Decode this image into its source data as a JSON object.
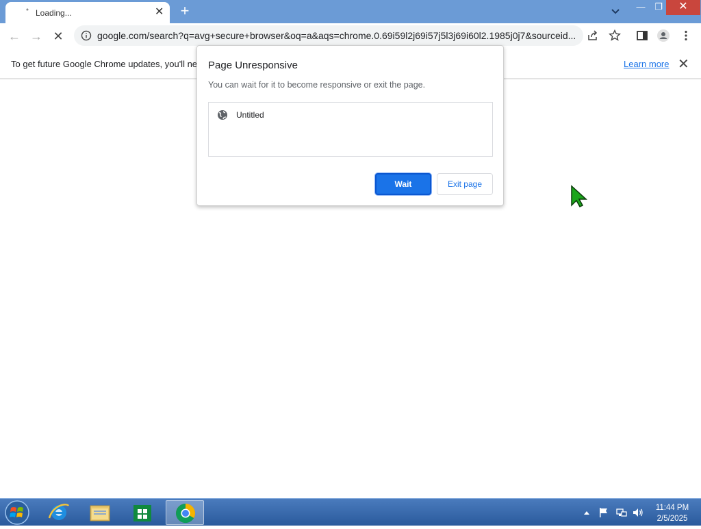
{
  "browser": {
    "tab": {
      "title": "Loading...",
      "spinner": "*"
    },
    "new_tab": "+",
    "window_controls": {
      "minimize": "—",
      "maximize": "❐",
      "close": "✕"
    },
    "nav": {
      "back": "←",
      "forward": "→",
      "stop": "✕"
    },
    "omnibox": {
      "url": "google.com/search?q=avg+secure+browser&oq=a&aqs=chrome.0.69i59l2j69i57j5l3j69i60l2.1985j0j7&sourceid..."
    }
  },
  "infobar": {
    "message": "To get future Google Chrome updates, you'll ne",
    "learn_more": "Learn more",
    "close": "✕"
  },
  "dialog": {
    "title": "Page Unresponsive",
    "text": "You can wait for it to become responsive or exit the page.",
    "pages": [
      "Untitled"
    ],
    "wait_label": "Wait",
    "exit_label": "Exit page"
  },
  "taskbar": {
    "time": "11:44 PM",
    "date": "2/5/2025",
    "apps": [
      "internet-explorer",
      "file-explorer",
      "store",
      "chrome"
    ]
  }
}
